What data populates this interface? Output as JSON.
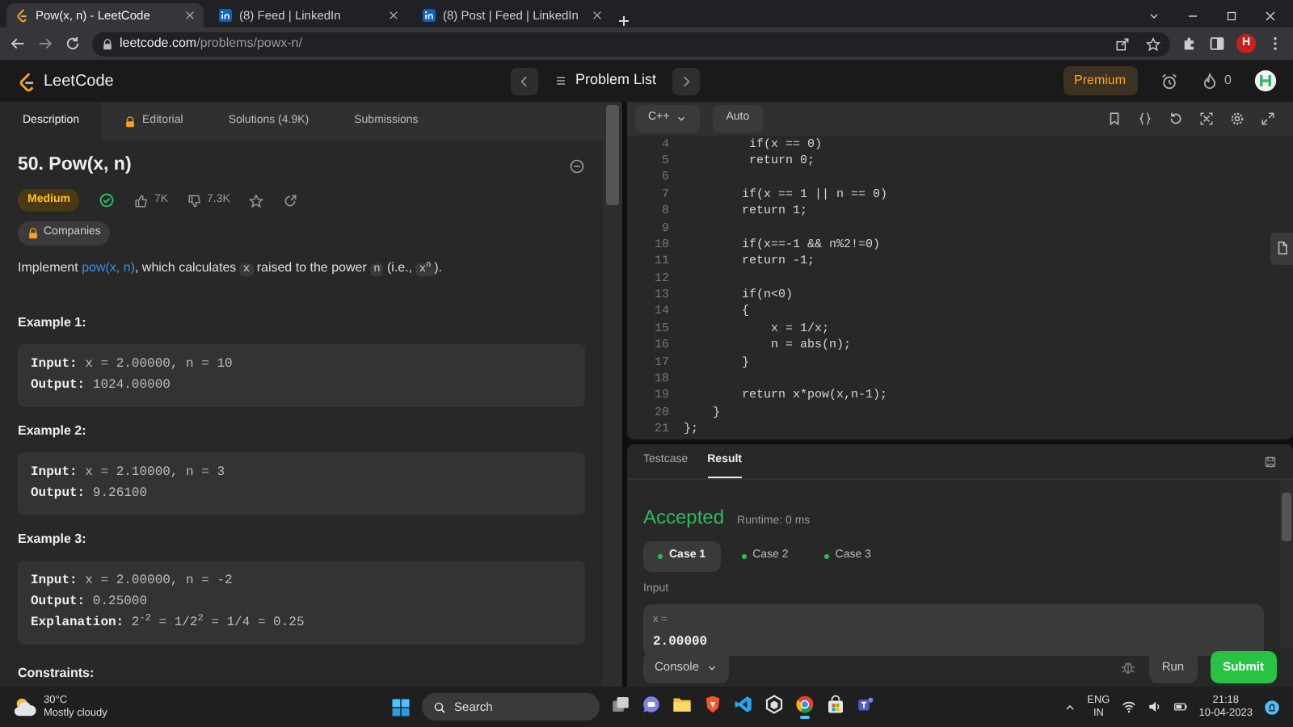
{
  "browser": {
    "tabs": [
      {
        "title": "Pow(x, n) - LeetCode",
        "kind": "leetcode",
        "selected": true
      },
      {
        "title": "(8) Feed | LinkedIn",
        "kind": "linkedin",
        "selected": false
      },
      {
        "title": "(8) Post | Feed | LinkedIn",
        "kind": "linkedin",
        "selected": false
      }
    ],
    "url": {
      "domain": "leetcode.com",
      "path": "/problems/powx-n/"
    },
    "profile_initial": "H"
  },
  "header": {
    "logo_text": "LeetCode",
    "problem_list": "Problem List",
    "premium": "Premium",
    "streak": "0"
  },
  "description_panel": {
    "tabs": [
      {
        "label": "Description",
        "locked": false,
        "selected": true
      },
      {
        "label": "Editorial",
        "locked": true,
        "selected": false
      },
      {
        "label": "Solutions (4.9K)",
        "locked": false,
        "selected": false
      },
      {
        "label": "Submissions",
        "locked": false,
        "selected": false
      }
    ],
    "title": "50. Pow(x, n)",
    "difficulty": "Medium",
    "solved": true,
    "likes": "7K",
    "dislikes": "7.3K",
    "companies": "Companies",
    "description": [
      {
        "kind": "text",
        "text": "Implement "
      },
      {
        "kind": "link",
        "text": "pow(x, n)"
      },
      {
        "kind": "text",
        "text": ", which calculates "
      },
      {
        "kind": "code",
        "text": "x"
      },
      {
        "kind": "text",
        "text": " raised to the power "
      },
      {
        "kind": "code",
        "text": "n"
      },
      {
        "kind": "text",
        "text": " (i.e., "
      },
      {
        "kind": "code",
        "text": "x$^{n}$"
      },
      {
        "kind": "text",
        "text": ")."
      }
    ],
    "examples": [
      {
        "title": "Example 1:",
        "lines": [
          {
            "label": "Input:",
            "value": "x = 2.00000, n = 10"
          },
          {
            "label": "Output:",
            "value": "1024.00000"
          }
        ]
      },
      {
        "title": "Example 2:",
        "lines": [
          {
            "label": "Input:",
            "value": "x = 2.10000, n = 3"
          },
          {
            "label": "Output:",
            "value": "9.26100"
          }
        ]
      },
      {
        "title": "Example 3:",
        "lines": [
          {
            "label": "Input:",
            "value": "x = 2.00000, n = -2"
          },
          {
            "label": "Output:",
            "value": "0.25000"
          },
          {
            "label": "Explanation:",
            "value": "2$^{-2}$ = 1/2$^{2}$ = 1/4 = 0.25"
          }
        ]
      }
    ],
    "constraints_title": "Constraints:"
  },
  "editor": {
    "language": "C++",
    "mode": "Auto",
    "lines": [
      {
        "number": "4",
        "code": "         if(x == 0)"
      },
      {
        "number": "5",
        "code": "         return 0;"
      },
      {
        "number": "6"
      },
      {
        "number": "7",
        "code": "        if(x == 1 || n == 0)"
      },
      {
        "number": "8",
        "code": "        return 1;"
      },
      {
        "number": "9"
      },
      {
        "number": "10",
        "code": "        if(x==-1 && n%2!=0)"
      },
      {
        "number": "11",
        "code": "        return -1;"
      },
      {
        "number": "12"
      },
      {
        "number": "13",
        "code": "        if(n<0)"
      },
      {
        "number": "14",
        "code": "        {"
      },
      {
        "number": "15",
        "code": "            x = 1/x;"
      },
      {
        "number": "16",
        "code": "            n = abs(n);"
      },
      {
        "number": "17",
        "code": "        }"
      },
      {
        "number": "18"
      },
      {
        "number": "19",
        "code": "        return x*pow(x,n-1);"
      },
      {
        "number": "20",
        "code": "    }"
      },
      {
        "number": "21",
        "code": "};"
      }
    ]
  },
  "result_panel": {
    "tabs": [
      {
        "label": "Testcase",
        "selected": false
      },
      {
        "label": "Result",
        "selected": true
      }
    ],
    "status": {
      "text": "Accepted",
      "kind": "accepted"
    },
    "runtime": "Runtime: 0 ms",
    "cases": [
      {
        "label": "Case 1",
        "passed": true,
        "selected": true
      },
      {
        "label": "Case 2",
        "passed": true,
        "selected": false
      },
      {
        "label": "Case 3",
        "passed": true,
        "selected": false
      }
    ],
    "input_label": "Input",
    "param_name": "x =",
    "param_value": "2.00000",
    "console": "Console",
    "run": "Run",
    "submit": "Submit"
  },
  "taskbar": {
    "temperature": "30°C",
    "weather": "Mostly cloudy",
    "search": "Search",
    "apps": [
      {
        "kind": "taskview",
        "active": false
      },
      {
        "kind": "chat",
        "active": false
      },
      {
        "kind": "folder",
        "active": false
      },
      {
        "kind": "shield",
        "active": false
      },
      {
        "kind": "code",
        "active": false
      },
      {
        "kind": "hexagon",
        "active": false
      },
      {
        "kind": "browser",
        "active": true
      },
      {
        "kind": "store",
        "active": false
      },
      {
        "kind": "people",
        "active": false
      }
    ],
    "language": "ENG",
    "region": "IN",
    "time": "21:18",
    "date": "10-04-2023"
  }
}
